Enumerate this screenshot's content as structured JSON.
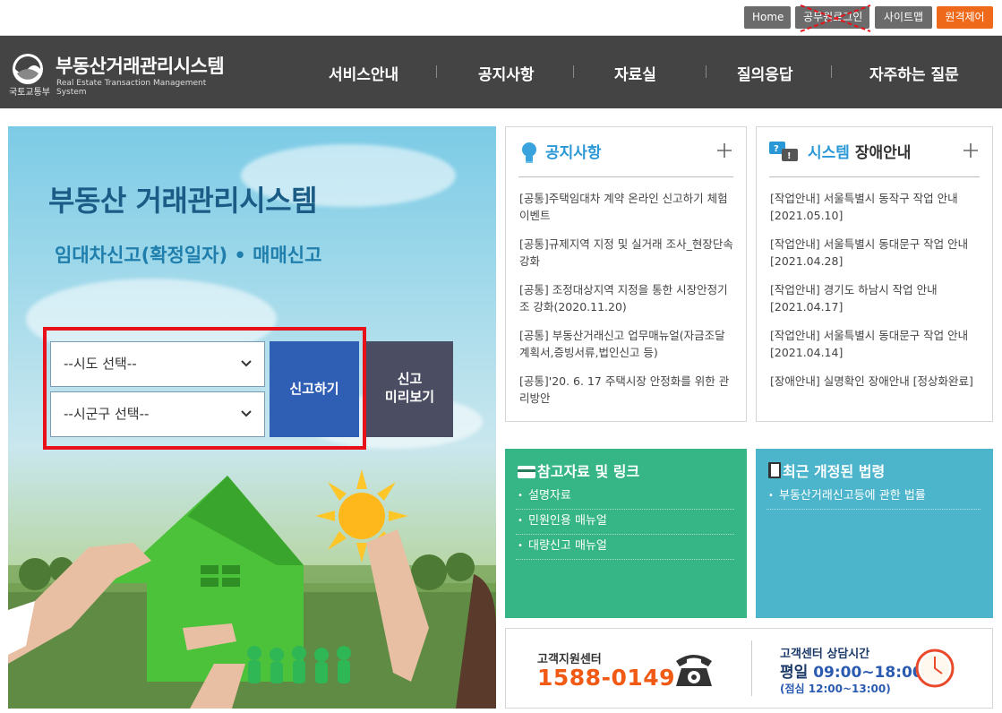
{
  "topbar": {
    "home": "Home",
    "official_login": "공무원로그인",
    "sitemap": "사이트맵",
    "remote": "원격제어"
  },
  "header": {
    "ministry": "국토교통부",
    "title_ko": "부동산거래관리시스템",
    "title_en": "Real Estate Transaction Management System",
    "nav": [
      "서비스안내",
      "공지사항",
      "자료실",
      "질의응답",
      "자주하는 질문"
    ]
  },
  "hero": {
    "title": "부동산 거래관리시스템",
    "subtitle": "임대차신고(확정일자) • 매매신고",
    "sido_select": "--시도 선택--",
    "sigungu_select": "--시군구 선택--",
    "report_button": "신고하기",
    "preview_button_line1": "신고",
    "preview_button_line2": "미리보기"
  },
  "notice": {
    "title": "공지사항",
    "items": [
      "[공통]주택임대차 계약 온라인 신고하기 체험 이벤트",
      "[공통]규제지역 지정 및 실거래 조사_현장단속 강화",
      "[공통] 조정대상지역 지정을 통한 시장안정기조 강화(2020.11.20)",
      "[공통] 부동산거래신고 업무매뉴얼(자금조달계획서,증빙서류,법인신고 등)",
      "[공통]'20. 6. 17 주택시장 안정화를 위한 관리방안"
    ]
  },
  "outage": {
    "title_accent": "시스템",
    "title_rest": " 장애안내",
    "items": [
      "[작업안내] 서울특별시 동작구 작업 안내 [2021.05.10]",
      "[작업안내] 서울특별시 동대문구 작업 안내 [2021.04.28]",
      "[작업안내] 경기도 하남시 작업 안내 [2021.04.17]",
      "[작업안내] 서울특별시 동대문구 작업 안내 [2021.04.14]",
      "[장애안내] 실명확인 장애안내 [정상화완료]"
    ]
  },
  "references": {
    "title": "참고자료 및 링크",
    "items": [
      "설명자료",
      "민원인용 매뉴얼",
      "대량신고 매뉴얼"
    ],
    "color": "#36b686"
  },
  "laws": {
    "title": "최근 개정된 법령",
    "items": [
      "부동산거래신고등에 관한 법률"
    ],
    "color": "#4cb5cb"
  },
  "customer_center": {
    "label": "고객지원센터",
    "phone": "1588-0149",
    "hours_label": "고객센터 상담시간",
    "hours_day": "평일",
    "hours_time": "09:00~18:00",
    "lunch": "(점심 12:00~13:00)"
  },
  "icons": [
    "emblem-icon",
    "bulb-icon",
    "chat-icon",
    "plus-icon",
    "card-icon",
    "book-icon",
    "telephone-icon",
    "clock-icon",
    "chevron-down-icon"
  ]
}
